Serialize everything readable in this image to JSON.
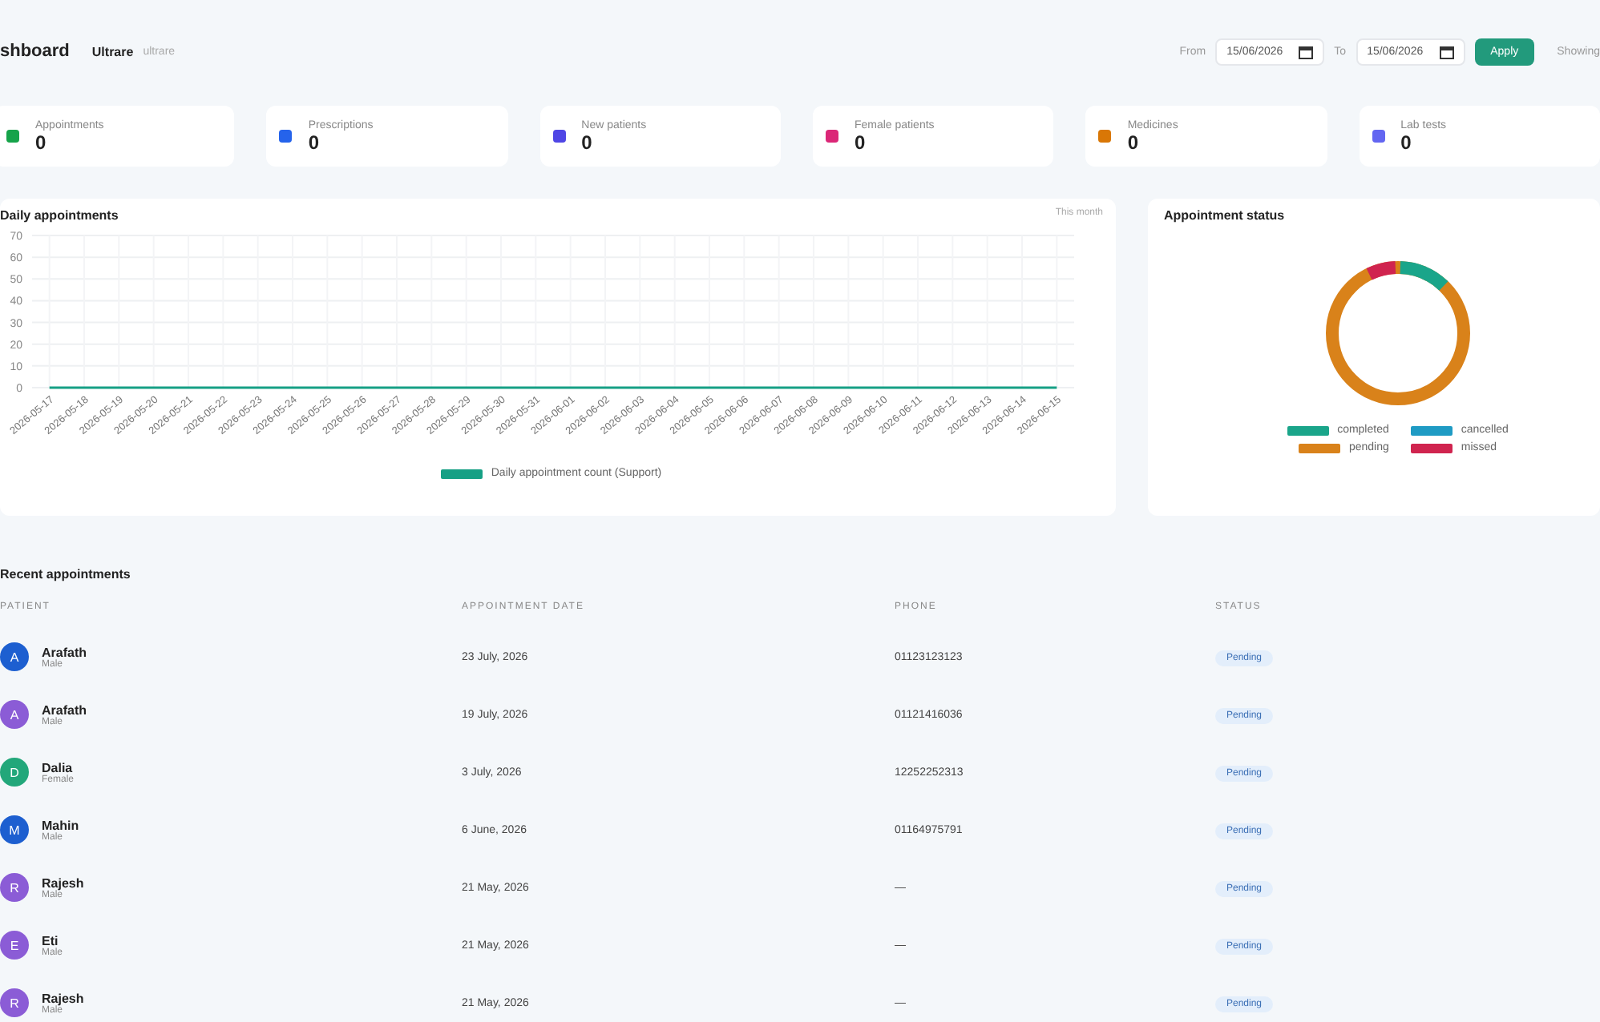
{
  "header": {
    "title": "shboard",
    "user_name": "Ultrare",
    "user_role": "ultrare",
    "from_label": "From",
    "from_date": "15/06/2026",
    "to_label": "To",
    "to_date": "15/06/2026",
    "apply": "Apply",
    "cut_text": "Showing"
  },
  "stats": [
    {
      "label": "Appointments",
      "value": "0",
      "color": "#16a34a"
    },
    {
      "label": "Prescriptions",
      "value": "0",
      "color": "#2563eb"
    },
    {
      "label": "New patients",
      "value": "0",
      "color": "#4f46e5"
    },
    {
      "label": "Female patients",
      "value": "0",
      "color": "#db2777"
    },
    {
      "label": "Medicines",
      "value": "0",
      "color": "#d97706"
    },
    {
      "label": "Lab tests",
      "value": "0",
      "color": "#6366f1"
    }
  ],
  "daily": {
    "title": "Daily appointments",
    "period": "This month",
    "chart_data": {
      "type": "line",
      "categories": [
        "2026-05-17",
        "2026-05-18",
        "2026-05-19",
        "2026-05-20",
        "2026-05-21",
        "2026-05-22",
        "2026-05-23",
        "2026-05-24",
        "2026-05-25",
        "2026-05-26",
        "2026-05-27",
        "2026-05-28",
        "2026-05-29",
        "2026-05-30",
        "2026-05-31",
        "2026-06-01",
        "2026-06-02",
        "2026-06-03",
        "2026-06-04",
        "2026-06-05",
        "2026-06-06",
        "2026-06-07",
        "2026-06-08",
        "2026-06-09",
        "2026-06-10",
        "2026-06-11",
        "2026-06-12",
        "2026-06-13",
        "2026-06-14",
        "2026-06-15"
      ],
      "series": [
        {
          "name": "Daily appointment count (Support)",
          "color": "#16a085",
          "values": [
            0,
            0,
            0,
            0,
            0,
            0,
            0,
            0,
            0,
            0,
            0,
            0,
            0,
            0,
            0,
            0,
            0,
            0,
            0,
            0,
            0,
            0,
            0,
            0,
            0,
            0,
            0,
            0,
            0,
            0
          ]
        }
      ],
      "grid": true,
      "ylim": [
        0,
        70
      ],
      "yticks": [
        0,
        10,
        20,
        30,
        40,
        50,
        60,
        70
      ]
    }
  },
  "status": {
    "title": "Appointment status",
    "legend": [
      {
        "label": "completed",
        "color": "#1aa58a"
      },
      {
        "label": "cancelled",
        "color": "#1f9bc4"
      },
      {
        "label": "pending",
        "color": "#d9821a"
      },
      {
        "label": "missed",
        "color": "#d0244f"
      }
    ]
  },
  "recent": {
    "title": "Recent appointments",
    "columns": [
      "PATIENT",
      "APPOINTMENT DATE",
      "PHONE",
      "STATUS"
    ],
    "rows": [
      {
        "initial": "A",
        "color": "#1d5fd0",
        "name": "Arafath",
        "gender": "Male",
        "date": "23 July, 2026",
        "phone": "01123123123",
        "status": "Pending"
      },
      {
        "initial": "A",
        "color": "#8b5cd6",
        "name": "Arafath",
        "gender": "Male",
        "date": "19 July, 2026",
        "phone": "01121416036",
        "status": "Pending"
      },
      {
        "initial": "D",
        "color": "#22a77a",
        "name": "Dalia",
        "gender": "Female",
        "date": "3 July, 2026",
        "phone": "12252252313",
        "status": "Pending"
      },
      {
        "initial": "M",
        "color": "#1d5fd0",
        "name": "Mahin",
        "gender": "Male",
        "date": "6 June, 2026",
        "phone": "01164975791",
        "status": "Pending"
      },
      {
        "initial": "R",
        "color": "#8b5cd6",
        "name": "Rajesh",
        "gender": "Male",
        "date": "21 May, 2026",
        "phone": "—",
        "status": "Pending"
      },
      {
        "initial": "E",
        "color": "#8b5cd6",
        "name": "Eti",
        "gender": "Male",
        "date": "21 May, 2026",
        "phone": "—",
        "status": "Pending"
      },
      {
        "initial": "R",
        "color": "#8b5cd6",
        "name": "Rajesh",
        "gender": "Male",
        "date": "21 May, 2026",
        "phone": "—",
        "status": "Pending"
      }
    ]
  }
}
